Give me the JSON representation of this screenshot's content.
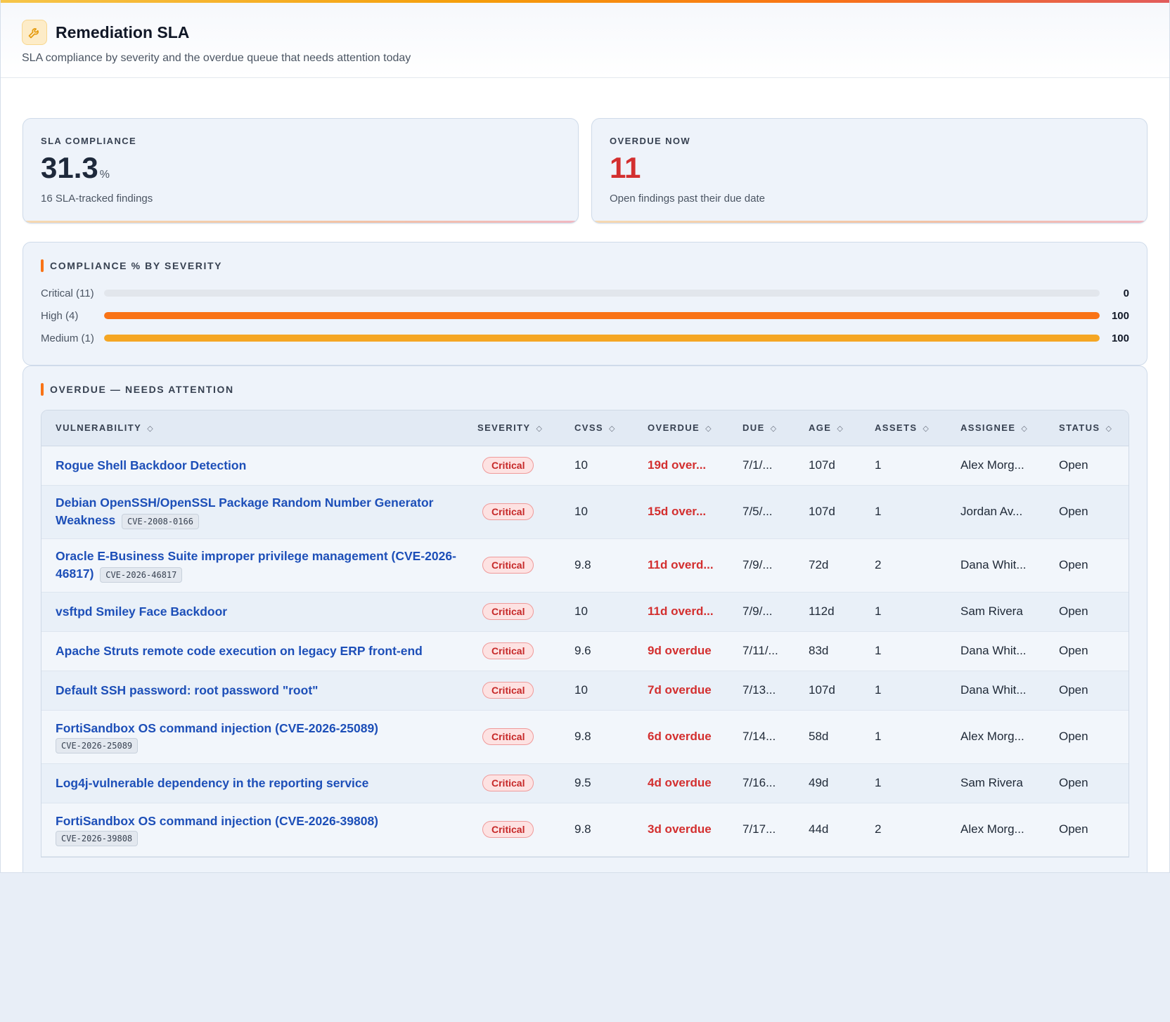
{
  "header": {
    "title": "Remediation SLA",
    "subtitle": "SLA compliance by severity and the overdue queue that needs attention today",
    "icon": "wrench-icon"
  },
  "kpis": {
    "compliance": {
      "label": "SLA COMPLIANCE",
      "value": "31.3",
      "unit": "%",
      "note": "16 SLA-tracked findings"
    },
    "overdue": {
      "label": "OVERDUE NOW",
      "value": "11",
      "note": "Open findings past their due date"
    }
  },
  "severity_section": {
    "title": "COMPLIANCE % BY SEVERITY",
    "rows": [
      {
        "label": "Critical (11)",
        "value": 0,
        "display": "0",
        "color": "#d1d5db"
      },
      {
        "label": "High (4)",
        "value": 100,
        "display": "100",
        "color": "#f97316"
      },
      {
        "label": "Medium (1)",
        "value": 100,
        "display": "100",
        "color": "#f5a623"
      }
    ]
  },
  "overdue_section": {
    "title": "OVERDUE — NEEDS ATTENTION",
    "columns": [
      "VULNERABILITY",
      "SEVERITY",
      "CVSS",
      "OVERDUE",
      "DUE",
      "AGE",
      "ASSETS",
      "ASSIGNEE",
      "STATUS"
    ],
    "rows": [
      {
        "name": "Rogue Shell Backdoor Detection",
        "cve": "",
        "severity": "Critical",
        "cvss": "10",
        "overdue": "19d over...",
        "due": "7/1/...",
        "age": "107d",
        "assets": "1",
        "assignee": "Alex Morg...",
        "status": "Open"
      },
      {
        "name": "Debian OpenSSH/OpenSSL Package Random Number Generator Weakness",
        "cve": "CVE-2008-0166",
        "severity": "Critical",
        "cvss": "10",
        "overdue": "15d over...",
        "due": "7/5/...",
        "age": "107d",
        "assets": "1",
        "assignee": "Jordan Av...",
        "status": "Open"
      },
      {
        "name": "Oracle E-Business Suite improper privilege management (CVE-2026-46817)",
        "cve": "CVE-2026-46817",
        "severity": "Critical",
        "cvss": "9.8",
        "overdue": "11d overd...",
        "due": "7/9/...",
        "age": "72d",
        "assets": "2",
        "assignee": "Dana Whit...",
        "status": "Open"
      },
      {
        "name": "vsftpd Smiley Face Backdoor",
        "cve": "",
        "severity": "Critical",
        "cvss": "10",
        "overdue": "11d overd...",
        "due": "7/9/...",
        "age": "112d",
        "assets": "1",
        "assignee": "Sam Rivera",
        "status": "Open"
      },
      {
        "name": "Apache Struts remote code execution on legacy ERP front-end",
        "cve": "",
        "severity": "Critical",
        "cvss": "9.6",
        "overdue": "9d overdue",
        "due": "7/11/...",
        "age": "83d",
        "assets": "1",
        "assignee": "Dana Whit...",
        "status": "Open"
      },
      {
        "name": "Default SSH password: root password \"root\"",
        "cve": "",
        "severity": "Critical",
        "cvss": "10",
        "overdue": "7d overdue",
        "due": "7/13...",
        "age": "107d",
        "assets": "1",
        "assignee": "Dana Whit...",
        "status": "Open"
      },
      {
        "name": "FortiSandbox OS command injection (CVE-2026-25089)",
        "cve": "CVE-2026-25089",
        "cveBlock": true,
        "severity": "Critical",
        "cvss": "9.8",
        "overdue": "6d overdue",
        "due": "7/14...",
        "age": "58d",
        "assets": "1",
        "assignee": "Alex Morg...",
        "status": "Open"
      },
      {
        "name": "Log4j-vulnerable dependency in the reporting service",
        "cve": "",
        "severity": "Critical",
        "cvss": "9.5",
        "overdue": "4d overdue",
        "due": "7/16...",
        "age": "49d",
        "assets": "1",
        "assignee": "Sam Rivera",
        "status": "Open"
      },
      {
        "name": "FortiSandbox OS command injection (CVE-2026-39808)",
        "cve": "CVE-2026-39808",
        "cveBlock": true,
        "severity": "Critical",
        "cvss": "9.8",
        "overdue": "3d overdue",
        "due": "7/17...",
        "age": "44d",
        "assets": "2",
        "assignee": "Alex Morg...",
        "status": "Open"
      }
    ]
  }
}
